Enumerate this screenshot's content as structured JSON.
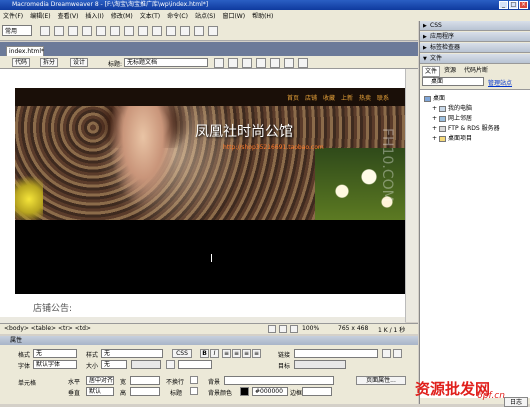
{
  "window": {
    "title": "Macromedia Dreamweaver 8 - [F:\\淘宝\\淘宝推广库\\wp\\index.html*]"
  },
  "menu": [
    "文件(F)",
    "编辑(E)",
    "查看(V)",
    "插入(I)",
    "修改(M)",
    "文本(T)",
    "命令(C)",
    "站点(S)",
    "窗口(W)",
    "帮助(H)"
  ],
  "insert_bar": {
    "category": "常用"
  },
  "document": {
    "tab": "index.html*",
    "views": {
      "code": "代码",
      "split": "拆分",
      "design": "设计"
    },
    "title_label": "标题:",
    "title_value": "无标题文档"
  },
  "page": {
    "nav": [
      "首页",
      "店铺",
      "收藏",
      "上新",
      "热卖",
      "联系"
    ],
    "shop_title": "凤凰社时尚公馆",
    "shop_url": "http://shop35216691.taobao.com",
    "watermark": "FH10.COM",
    "announcement": "店铺公告:"
  },
  "status": {
    "tags": "<body> <table> <tr> <td>",
    "zoom": "100%",
    "size": "765 x 468",
    "file": "1 K / 1 秒"
  },
  "properties": {
    "header": "属性",
    "format_label": "格式",
    "format_value": "无",
    "style_label": "样式",
    "style_value": "无",
    "css_button": "CSS",
    "link_label": "链接",
    "font_label": "字体",
    "font_value": "默认字体",
    "size_label": "大小",
    "size_value": "无",
    "target_label": "目标",
    "cell_label": "单元格",
    "horz_label": "水平",
    "horz_value": "居中对齐",
    "width_label": "宽",
    "nowrap_label": "不换行",
    "bg_label": "背景",
    "page_props_button": "页面属性...",
    "vert_label": "垂直",
    "vert_value": "默认",
    "height_label": "高",
    "header_label": "标题",
    "bgcolor_label": "背景颜色",
    "bgcolor_value": "#000000",
    "border_label": "边框"
  },
  "right_panel": {
    "groups": [
      "CSS",
      "应用程序",
      "标签检查器",
      "文件"
    ],
    "file_tabs": [
      "文件",
      "资源",
      "代码片断"
    ],
    "site_select": "桌面",
    "manage_link": "管理站点",
    "tree": [
      "桌面",
      "我的电脑",
      "网上邻居",
      "FTP & RDS 服务器",
      "桌面项目"
    ],
    "log_button": "日志"
  },
  "brand": {
    "text": "资源批发网",
    "url": "6pf.cn"
  }
}
